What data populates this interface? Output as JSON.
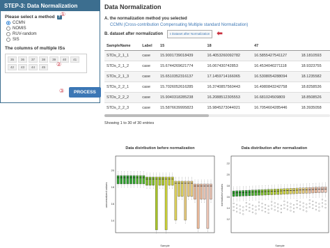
{
  "left_panel": {
    "header": "STEP-3: Data Normalization",
    "method_label": "Please select a method",
    "help": "?",
    "circle1": "①",
    "circle2": "②",
    "circle3": "③",
    "methods": [
      "CCMN",
      "NOMIS",
      "RUV-random",
      "SIS"
    ],
    "selected_method": "CCMN",
    "columns_label": "The columns of multiple ISs",
    "is_columns": [
      "35",
      "36",
      "37",
      "38",
      "39",
      "40",
      "41",
      "42",
      "43",
      "44",
      "45"
    ],
    "process_label": "PROCESS"
  },
  "main": {
    "title": "Data Normalization",
    "section_a": "A. the normalization method you selected",
    "method_full": "CCMN (Cross-contribution Compensating Multiple standard Normalization)",
    "section_b": "B. dataset after normalization",
    "download_label": "⭳ Dataset after Normalization",
    "arrow": "⬅",
    "columns": [
      "SampleName",
      "Label",
      "15",
      "18",
      "47",
      ""
    ],
    "rows": [
      [
        "STDs_2_1_1",
        "case",
        "15.9001739018439",
        "16.4053260092782",
        "16.5855427541127",
        "18.1810593"
      ],
      [
        "STDs_2_1_2",
        "case",
        "15.6744269621774",
        "16.067430742853",
        "16.4534040271118",
        "18.9323755"
      ],
      [
        "STDs_2_1_3",
        "case",
        "15.6510352316137",
        "17.1459714166065",
        "16.5308054288094",
        "18.1235582"
      ],
      [
        "STDs_2_2_1",
        "case",
        "15.7026052616285",
        "16.3740857560443",
        "16.4980843242758",
        "18.8258536"
      ],
      [
        "STDs_2_2_2",
        "case",
        "15.9040318285238",
        "16.2088512305553",
        "16.681024509809",
        "18.8508526"
      ],
      [
        "STDs_2_2_3",
        "case",
        "15.5876639995823",
        "15.9845273044021",
        "16.7054604285446",
        "18.3935058"
      ]
    ],
    "entries": "Showing 1 to 30 of 30 entries"
  },
  "plots": {
    "before_title": "Data distribution before normalization",
    "after_title": "Data distribution after normalization",
    "before_ylabel": "unnormalized values",
    "after_ylabel": "normalized values",
    "xlabel": "Sample",
    "before_yticks": [
      "20",
      "18",
      "16",
      "14"
    ],
    "after_yticks": [
      "22",
      "20",
      "18",
      "16",
      "14",
      "12"
    ]
  }
}
